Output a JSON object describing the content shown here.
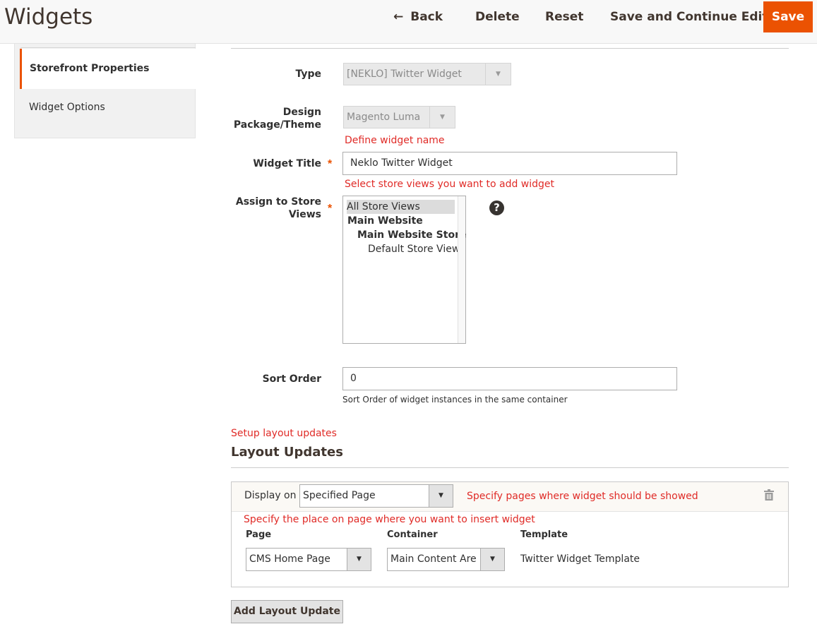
{
  "header": {
    "title": "Widgets",
    "back_label": "Back",
    "delete_label": "Delete",
    "reset_label": "Reset",
    "save_continue_label": "Save and Continue Edit",
    "save_label": "Save"
  },
  "sidebar": {
    "items": [
      {
        "label": "Storefront Properties",
        "active": true
      },
      {
        "label": "Widget Options",
        "active": false
      }
    ]
  },
  "form": {
    "type": {
      "label": "Type",
      "value": "[NEKLO] Twitter Widget"
    },
    "design": {
      "label_line1": "Design",
      "label_line2": "Package/Theme",
      "value": "Magento Luma"
    },
    "widget_title": {
      "hint": "Define widget name",
      "label": "Widget Title",
      "value": "Neklo Twitter Widget",
      "required_mark": "*"
    },
    "store_views": {
      "hint": "Select store views you want to add widget",
      "label_line1": "Assign to Store",
      "label_line2": "Views",
      "required_mark": "*",
      "options": [
        "All Store Views",
        "Main Website",
        "Main Website Store",
        "Default Store View"
      ],
      "selected": "All Store Views",
      "help_icon": "?"
    },
    "sort_order": {
      "label": "Sort Order",
      "value": "0",
      "note": "Sort Order of widget instances in the same container"
    }
  },
  "layout_updates": {
    "setup_hint": "Setup layout updates",
    "title": "Layout Updates",
    "display_on_label": "Display on",
    "display_on_value": "Specified Page",
    "display_hint": "Specify pages where widget should be showed",
    "place_hint": "Specify the place on page where you want to insert widget",
    "columns": {
      "page": "Page",
      "container": "Container",
      "template": "Template"
    },
    "page_value": "CMS Home Page",
    "container_value": "Main Content Area",
    "template_value": "Twitter Widget Template",
    "add_button_label": "Add Layout Update"
  },
  "icons": {
    "back": "arrow-left-icon",
    "delete": "trash-icon",
    "help": "question-icon",
    "dropdown": "chevron-down-icon"
  },
  "colors": {
    "accent": "#eb5202",
    "hint_red": "#e02b27"
  }
}
